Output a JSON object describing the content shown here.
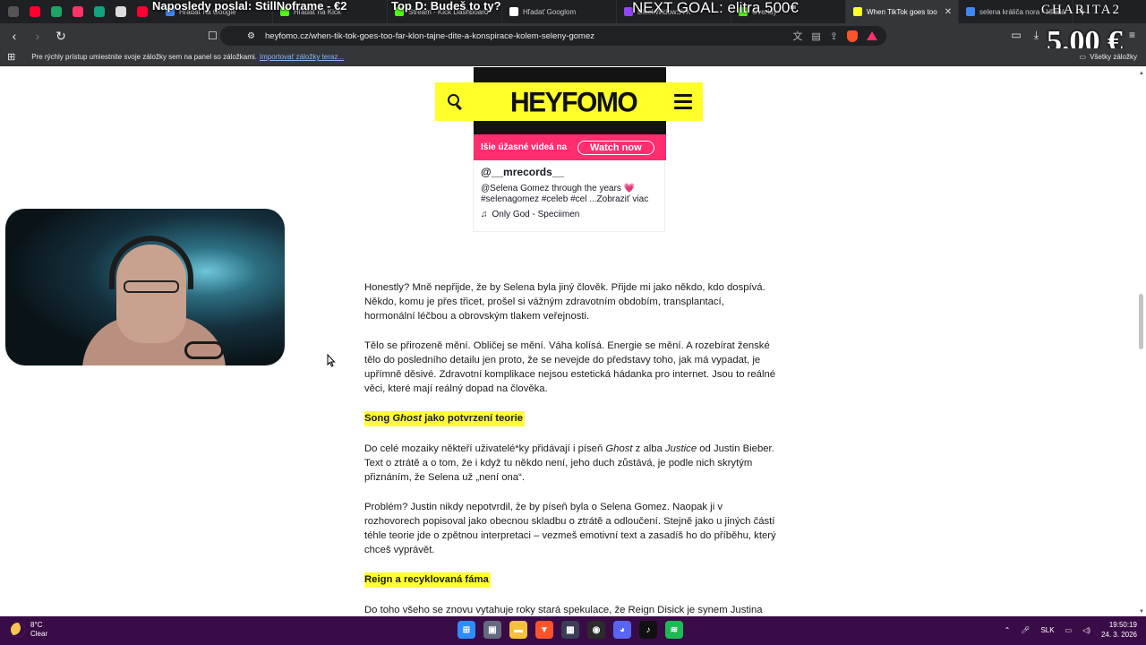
{
  "browser": {
    "pinned_tabs": [
      {
        "icon": "brave-icon",
        "color": "#555555"
      },
      {
        "icon": "youtube-icon",
        "color": "#ff0033"
      },
      {
        "icon": "drive-icon",
        "color": "#1fa463"
      },
      {
        "icon": "app-icon",
        "color": "#ff3366"
      },
      {
        "icon": "chatgpt-icon",
        "color": "#10a37f"
      },
      {
        "icon": "anchor-icon",
        "color": "#dddddd"
      },
      {
        "icon": "youtube-icon",
        "color": "#ff0033"
      }
    ],
    "tabs": [
      {
        "label": "Hľadať na Google",
        "fav": "#4285f4",
        "active": false
      },
      {
        "label": "Hľadať na Kick",
        "fav": "#53fc18",
        "active": false
      },
      {
        "label": "Stream - Kick Dashboard",
        "fav": "#53fc18",
        "active": false
      },
      {
        "label": "Hľadať Googlom",
        "fav": "#ffffff",
        "active": false
      },
      {
        "label": "BlackWidowSVK",
        "fav": "#9146ff",
        "active": false
      },
      {
        "label": "Overlay",
        "fav": "#53fc18",
        "active": false
      },
      {
        "label": "When TikTok goes too",
        "fav": "#ffff2a",
        "active": true
      },
      {
        "label": "selena králiča nora - Hľadá",
        "fav": "#4285f4",
        "active": false
      }
    ],
    "address_url": "heyfomo.cz/when-tik-tok-goes-too-far-klon-tajne-dite-a-konspirace-kolem-seleny-gomez",
    "bookmarks_hint": "Pre rýchly prístup umiestnite svoje záložky sem na panel so záložkami.",
    "bookmarks_import": "Importovať záložky teraz...",
    "all_bookmarks": "Všetky záložky"
  },
  "overlay": {
    "last_sent": "Naposledy poslal: StillNoframe - €2",
    "top_donor": "Top D: Budeš to ty?",
    "next_goal": "NEXT GOAL: elitra 500€",
    "charity": "CHARITA2",
    "amount": "5.00 €"
  },
  "site": {
    "logo": "HEYFOMO"
  },
  "tiktok": {
    "promo_text": "Išie úžasné videá na",
    "watch_now": "Watch now",
    "username": "@__mrecords__",
    "caption": "@Selena Gomez through the years 💗 #selenagomez #celeb #cel ...",
    "see_more": "Zobraziť viac",
    "music": "Only God - Speciimen"
  },
  "article": {
    "p1": "Honestly? Mně nepřijde, že by Selena byla jiný člověk. Přijde mi jako někdo, kdo dospívá. Někdo, komu je přes třicet, prošel si vážným zdravotním obdobím, transplantací, hormonální léčbou a obrovským tlakem veřejnosti.",
    "p2": "Tělo se přirozeně mění. Obličej se mění. Váha kolísá. Energie se mění. A rozebírat ženské tělo do posledního detailu jen proto, že se nevejde do představy toho, jak má vypadat, je upřímně děsivé. Zdravotní komplikace nejsou estetická hádanka pro internet. Jsou to reálné věci, které mají reálný dopad na člověka.",
    "h1_pre": "Song ",
    "h1_em": "Ghost",
    "h1_post": " jako potvrzení teorie",
    "p3_a": "Do celé mozaiky někteří uživatelé*ky přidávají i píseň ",
    "p3_ghost": "Ghost",
    "p3_b": " z alba ",
    "p3_justice": "Justice",
    "p3_c": " od Justin Bieber. Text o ztrátě a o tom, že i když tu někdo není, jeho duch zůstává, je podle nich skrytým přiznáním, že Selena už „není ona“.",
    "p4": "Problém? Justin nikdy nepotvrdil, že by píseň byla o Selena Gomez. Naopak ji v rozhovorech popisoval jako obecnou skladbu o ztrátě a odloučení. Stejně jako u jiných částí téhle teorie jde o zpětnou interpretaci – vezmeš emotivní text a zasadíš ho do příběhu, který chceš vyprávět.",
    "h2": "Reign a recyklovaná fáma",
    "p5": "Do toho všeho se znovu vytahuje roky stará spekulace, že Reign Disick je synem Justina"
  },
  "taskbar": {
    "temp": "8°C",
    "condition": "Clear",
    "lang": "SLK",
    "time": "19:50:19",
    "date": "24. 3. 2026",
    "apps": [
      {
        "icon": "windows-start-icon",
        "color": "#2f8cff",
        "glyph": "⊞"
      },
      {
        "icon": "task-view-icon",
        "color": "#666a80",
        "glyph": "▣"
      },
      {
        "icon": "file-explorer-icon",
        "color": "#f3c13a",
        "glyph": "▬"
      },
      {
        "icon": "brave-browser-icon",
        "color": "#fb542b",
        "glyph": "▼"
      },
      {
        "icon": "store-icon",
        "color": "#3a3f55",
        "glyph": "▦"
      },
      {
        "icon": "obs-icon",
        "color": "#2b2b2b",
        "glyph": "◉"
      },
      {
        "icon": "discord-icon",
        "color": "#5865f2",
        "glyph": "◕"
      },
      {
        "icon": "tiktok-icon",
        "color": "#111111",
        "glyph": "♪"
      },
      {
        "icon": "spotify-icon",
        "color": "#1db954",
        "glyph": "≋"
      }
    ]
  }
}
